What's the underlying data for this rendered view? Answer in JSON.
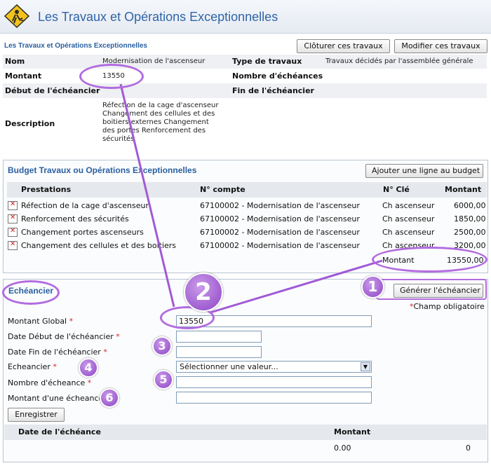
{
  "header": {
    "title": "Les Travaux et Opérations Exceptionnelles"
  },
  "details": {
    "section_link": "Les Travaux et Opérations Exceptionnelles",
    "close_button": "Clôturer ces travaux",
    "edit_button": "Modifier ces travaux",
    "nom_label": "Nom",
    "nom_value": "Modernisation de l'ascenseur",
    "type_label": "Type de travaux",
    "type_value": "Travaux décidés par l'assemblée générale",
    "montant_label": "Montant",
    "montant_value": "13550",
    "nb_echeances_label": "Nombre d'échéances",
    "debut_label": "Début de l'échéancier",
    "fin_label": "Fin de l'échéancier",
    "description_label": "Description",
    "description_value": "Réfection de la cage d'ascenseur Changement des cellules et des boitiers externes Changement des portes Renforcement des sécurités"
  },
  "budget": {
    "title": "Budget Travaux ou Opérations Exceptionnelles",
    "add_button": "Ajouter une ligne au budget",
    "columns": [
      "Prestations",
      "N° compte",
      "N° Clé",
      "Montant"
    ],
    "rows": [
      {
        "prestation": "Réfection de la cage d'ascenseur",
        "compte": "67100002 - Modernisation de l'ascenseur",
        "cle": "Ch ascenseur",
        "montant": "6000,00"
      },
      {
        "prestation": "Renforcement des sécurités",
        "compte": "67100002 - Modernisation de l'ascenseur",
        "cle": "Ch ascenseur",
        "montant": "1850,00"
      },
      {
        "prestation": "Changement portes ascenseurs",
        "compte": "67100002 - Modernisation de l'ascenseur",
        "cle": "Ch ascenseur",
        "montant": "2500,00"
      },
      {
        "prestation": "Changement des cellules et des boitiers",
        "compte": "67100002 - Modernisation de l'ascenseur",
        "cle": "Ch ascenseur",
        "montant": "3200,00"
      }
    ],
    "total_label": "Montant",
    "total_value": "13550,00"
  },
  "echeancier": {
    "title": "Echéancier",
    "generate_button": "Générer l'échéancier",
    "required_note": "Champ obligatoire",
    "required_mark": "*",
    "montant_global_label": "Montant Global",
    "montant_global_value": "13550",
    "date_debut_label": "Date Début de l'échéancier",
    "date_fin_label": "Date Fin de l'échéancier",
    "echeancier_label": "Echeancier",
    "select_placeholder": "Sélectionner une valeur...",
    "nombre_label": "Nombre d'écheance",
    "montant_une_label": "Montant d'une écheance",
    "save_button": "Enregistrer",
    "table_columns": [
      "Date de l'échéance",
      "Montant"
    ],
    "table_row": {
      "montant": "0.00",
      "extra": "0"
    }
  },
  "annotations": {
    "n1": "1",
    "n2": "2",
    "n3": "3",
    "n4": "4",
    "n5": "5",
    "n6": "6"
  },
  "colors": {
    "accent": "#2a5fa0",
    "annotation": "#a05ad6",
    "required": "#dd2222"
  }
}
